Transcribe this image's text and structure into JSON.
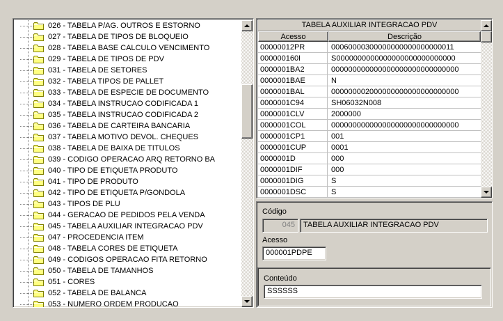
{
  "tree": {
    "items": [
      "026 - TABELA P/AG. OUTROS E ESTORNO",
      "027 - TABELA DE TIPOS DE BLOQUEIO",
      "028 - TABELA BASE CALCULO VENCIMENTO",
      "029 - TABELA DE TIPOS DE PDV",
      "031 - TABELA DE SETORES",
      "032 - TABELA TIPOS DE PALLET",
      "033 - TABELA DE ESPECIE DE DOCUMENTO",
      "034 - TABELA INSTRUCAO CODIFICADA 1",
      "035 - TABELA INSTRUCAO CODIFICADA 2",
      "036 - TABELA DE CARTEIRA BANCARIA",
      "037 - TABELA MOTIVO DEVOL. CHEQUES",
      "038 - TABELA DE BAIXA DE TITULOS",
      "039 - CODIGO OPERACAO ARQ RETORNO BA",
      "040 - TIPO DE ETIQUETA PRODUTO",
      "041 - TIPO DE PRODUTO",
      "042 - TIPO DE ETIQUETA P/GONDOLA",
      "043 - TIPOS DE PLU",
      "044 - GERACAO DE PEDIDOS PELA VENDA",
      "045 - TABELA AUXILIAR INTEGRACAO PDV",
      "047 - PROCEDENCIA ITEM",
      "048 - TABELA CORES DE ETIQUETA",
      "049 - CODIGOS OPERACAO FITA RETORNO",
      "050 - TABELA DE TAMANHOS",
      "051 - CORES",
      "052 - TABELA DE BALANCA",
      "053 - NUMERO ORDEM PRODUCAO"
    ]
  },
  "grid": {
    "title": "TABELA AUXILIAR INTEGRACAO PDV",
    "col_acesso": "Acesso",
    "col_descricao": "Descrição",
    "rows": [
      [
        "00000012PR",
        "00060000300000000000000000011"
      ],
      [
        "000000160I",
        "S0000000000000000000000000000"
      ],
      [
        "0000001BA2",
        "000000000000000000000000000000"
      ],
      [
        "0000001BAE",
        "N"
      ],
      [
        "0000001BAL",
        "000000002000000000000000000000"
      ],
      [
        "0000001C94",
        "SH06032N008"
      ],
      [
        "0000001CLV",
        "2000000"
      ],
      [
        "0000001COL",
        "000000000000000000000000000000"
      ],
      [
        "0000001CP1",
        "001"
      ],
      [
        "0000001CUP",
        "0001"
      ],
      [
        "0000001D",
        "000"
      ],
      [
        "0000001DIF",
        "000"
      ],
      [
        "0000001DIG",
        "S"
      ],
      [
        "0000001DSC",
        "S"
      ]
    ]
  },
  "form": {
    "codigo_label": "Código",
    "codigo_value": "045",
    "codigo_desc": "TABELA AUXILIAR INTEGRACAO PDV",
    "acesso_label": "Acesso",
    "acesso_value": "000001PDPE",
    "conteudo_label": "Conteúdo",
    "conteudo_value": "SSSSSS"
  },
  "colors": {
    "window_bg": "#d4d0c8",
    "folder_yellow": "#ffff80"
  }
}
